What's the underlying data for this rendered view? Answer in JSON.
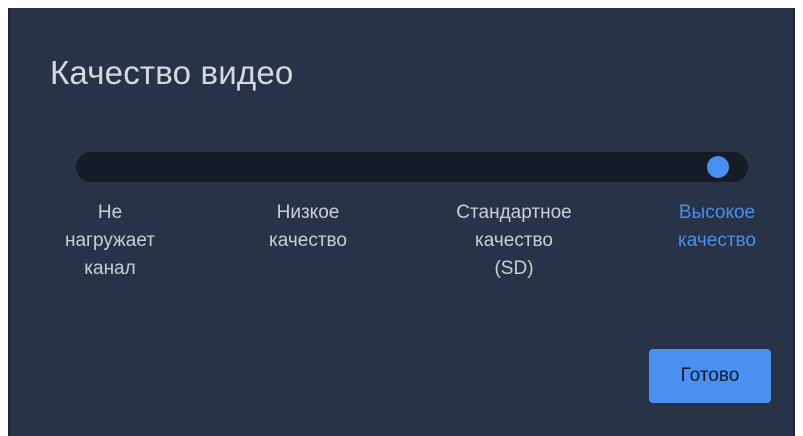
{
  "dialog": {
    "title": "Качество видео",
    "slider": {
      "selected_index": 3,
      "stops": [
        {
          "label": "Не\nнагружает\nканал",
          "active": false
        },
        {
          "label": "Низкое\nкачество",
          "active": false
        },
        {
          "label": "Стандартное\nкачество\n(SD)",
          "active": false
        },
        {
          "label": "Высокое\nкачество",
          "active": true
        }
      ]
    },
    "done_label": "Готово"
  },
  "colors": {
    "background": "#283347",
    "track": "#151c28",
    "accent": "#4a90f0",
    "text": "#c9ced8"
  }
}
